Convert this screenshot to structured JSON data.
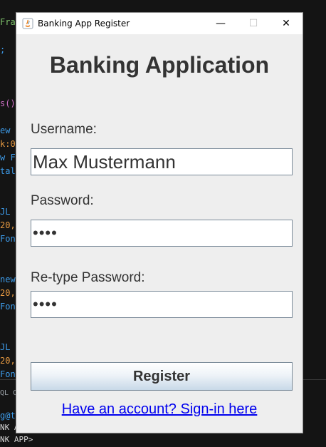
{
  "background_editor": {
    "lines": [
      {
        "text": "Fran",
        "color": "green"
      },
      {
        "text": ";",
        "color": "blue"
      },
      {
        "text": "s()",
        "color": "pink"
      },
      {
        "text": "ew",
        "color": "blue"
      },
      {
        "text": "k:0",
        "color": "orange"
      },
      {
        "text": "w F",
        "color": "blue"
      },
      {
        "text": "tal",
        "color": "blue"
      },
      {
        "text": "JL",
        "color": "blue"
      },
      {
        "text": "20,",
        "color": "orange"
      },
      {
        "text": "Fon",
        "color": "blue"
      },
      {
        "text": "new",
        "color": "blue"
      },
      {
        "text": "20,",
        "color": "orange"
      },
      {
        "text": "Fon",
        "color": "blue"
      },
      {
        "text": "JL",
        "color": "blue"
      },
      {
        "text": "20,",
        "color": "orange"
      },
      {
        "text": "Fon",
        "color": "blue"
      },
      {
        "text": "QL C",
        "color": "gray"
      },
      {
        "text": "g@t.",
        "color": "blue"
      },
      {
        "text": "NK A",
        "color": "white"
      },
      {
        "text": "NK APP>",
        "color": "white"
      }
    ]
  },
  "window": {
    "title": "Banking App Register",
    "controls": {
      "minimize": "—",
      "maximize": "☐",
      "close": "✕"
    }
  },
  "form": {
    "heading": "Banking Application",
    "username_label": "Username:",
    "username_value": "Max Mustermann",
    "password_label": "Password:",
    "password_value": "••••",
    "retype_label": "Re-type Password:",
    "retype_value": "••••",
    "register_button": "Register",
    "signin_link": "Have an account? Sign-in here"
  },
  "colors": {
    "window_bg": "#eeeeee",
    "link": "#0000ee",
    "heading": "#333333"
  }
}
